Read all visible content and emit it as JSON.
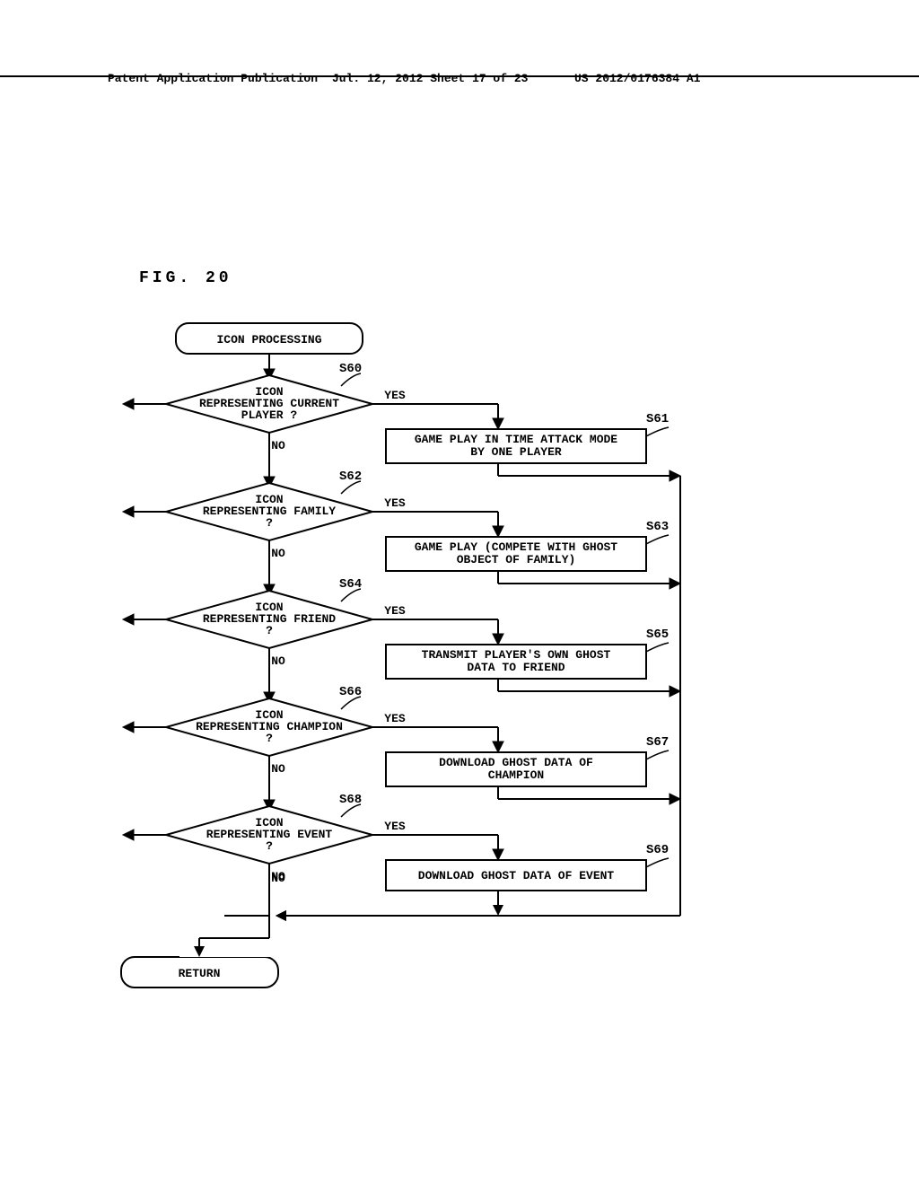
{
  "header": {
    "left": "Patent Application Publication",
    "mid": "Jul. 12, 2012  Sheet 17 of 23",
    "right": "US 2012/0176384 A1"
  },
  "figure_label": "FIG. 20",
  "nodes": {
    "start": "ICON PROCESSING",
    "d60_l1": "ICON",
    "d60_l2": "REPRESENTING CURRENT",
    "d60_l3": "PLAYER ?",
    "p61_l1": "GAME PLAY IN TIME ATTACK MODE",
    "p61_l2": "BY ONE PLAYER",
    "d62_l1": "ICON",
    "d62_l2": "REPRESENTING FAMILY",
    "d62_l3": "?",
    "p63_l1": "GAME PLAY (COMPETE WITH GHOST",
    "p63_l2": "OBJECT OF FAMILY)",
    "d64_l1": "ICON",
    "d64_l2": "REPRESENTING FRIEND",
    "d64_l3": "?",
    "p65_l1": "TRANSMIT PLAYER'S OWN GHOST",
    "p65_l2": "DATA TO FRIEND",
    "d66_l1": "ICON",
    "d66_l2": "REPRESENTING CHAMPION",
    "d66_l3": "?",
    "p67_l1": "DOWNLOAD GHOST DATA OF",
    "p67_l2": "CHAMPION",
    "d68_l1": "ICON",
    "d68_l2": "REPRESENTING EVENT",
    "d68_l3": "?",
    "p69": "DOWNLOAD GHOST DATA OF EVENT",
    "return": "RETURN"
  },
  "labels": {
    "yes": "YES",
    "no": "NO"
  },
  "refs": {
    "s60": "S60",
    "s61": "S61",
    "s62": "S62",
    "s63": "S63",
    "s64": "S64",
    "s65": "S65",
    "s66": "S66",
    "s67": "S67",
    "s68": "S68",
    "s69": "S69"
  }
}
